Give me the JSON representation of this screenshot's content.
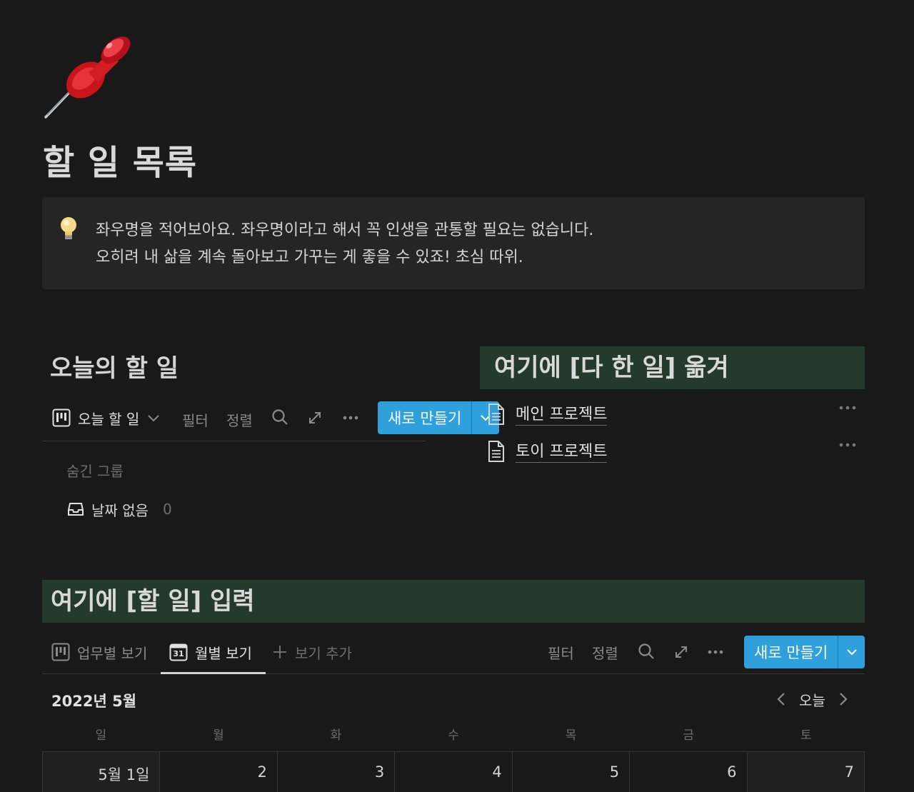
{
  "page": {
    "title": "할 일 목록",
    "icon": "pushpin-icon"
  },
  "callout": {
    "icon": "lightbulb-icon",
    "line1": "좌우명을 적어보아요. 좌우명이라고 해서 꼭 인생을 관통할 필요는 없습니다.",
    "line2": "오히려 내 삶을 계속 돌아보고 가꾸는 게 좋을 수 있죠! 초심 따위."
  },
  "today": {
    "heading": "오늘의 할 일",
    "view_label": "오늘 할 일",
    "filter": "필터",
    "sort": "정렬",
    "new_button": "새로 만들기",
    "hidden_groups": "숨긴 그룹",
    "no_date_label": "날짜 없음",
    "no_date_count": "0"
  },
  "done": {
    "heading": "여기에 [다 한 일] 옮겨",
    "projects": [
      {
        "title": "메인 프로젝트"
      },
      {
        "title": "토이 프로젝트"
      }
    ]
  },
  "todo_input": {
    "heading": "여기에 [할 일] 입력",
    "tabs": [
      {
        "label": "업무별 보기",
        "active": false
      },
      {
        "label": "월별 보기",
        "active": true
      },
      {
        "label": "보기 추가",
        "active": false
      }
    ],
    "calendar_icon_day": "31",
    "filter": "필터",
    "sort": "정렬",
    "new_button": "새로 만들기"
  },
  "calendar": {
    "month": "2022년 5월",
    "today_button": "오늘",
    "weekdays": [
      "일",
      "월",
      "화",
      "수",
      "목",
      "금",
      "토"
    ],
    "first_row": [
      "5월 1일",
      "2",
      "3",
      "4",
      "5",
      "6",
      "7"
    ]
  },
  "colors": {
    "background": "#191919",
    "accent": "#2ea1dc",
    "heading_highlight": "#243a2c",
    "callout_bg": "#252525"
  }
}
